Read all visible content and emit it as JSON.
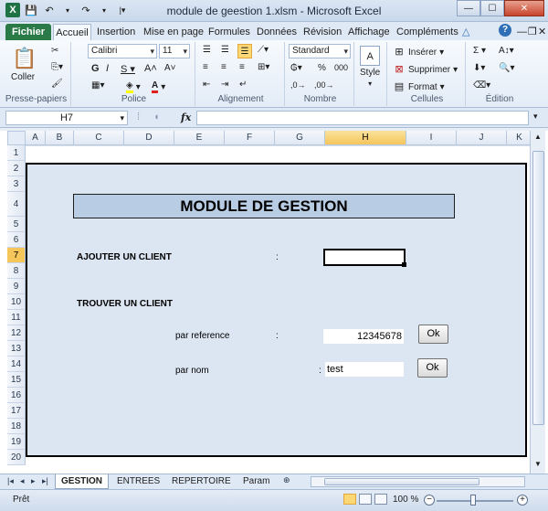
{
  "window": {
    "title": "module de geestion 1.xlsm  -  Microsoft Excel"
  },
  "ribbon": {
    "tabs": [
      "Fichier",
      "Accueil",
      "Insertion",
      "Mise en page",
      "Formules",
      "Données",
      "Révision",
      "Affichage",
      "Compléments"
    ],
    "active_tab": "Accueil",
    "clipboard": {
      "paste_label": "Coller",
      "group_label": "Presse-papiers"
    },
    "font": {
      "name": "Calibri",
      "size": "11",
      "group_label": "Police"
    },
    "alignment": {
      "group_label": "Alignement"
    },
    "number": {
      "format": "Standard",
      "group_label": "Nombre"
    },
    "styles": {
      "label": "Style"
    },
    "cells": {
      "insert": "Insérer",
      "delete": "Supprimer",
      "format": "Format",
      "group_label": "Cellules"
    },
    "editing": {
      "group_label": "Édition"
    }
  },
  "formula_bar": {
    "cell_ref": "H7",
    "fx": "fx",
    "content": ""
  },
  "grid": {
    "columns": [
      "A",
      "B",
      "C",
      "D",
      "E",
      "F",
      "G",
      "H",
      "I",
      "J",
      "K"
    ],
    "selected_column": "H",
    "rows": [
      "1",
      "2",
      "3",
      "4",
      "5",
      "6",
      "7",
      "8",
      "9",
      "10",
      "11",
      "12",
      "13",
      "14",
      "15",
      "16",
      "17",
      "18",
      "19",
      "20"
    ],
    "selected_row": "7"
  },
  "sheet": {
    "title": "MODULE DE GESTION",
    "add_client_label": "AJOUTER UN CLIENT",
    "colon": ":",
    "find_client_label": "TROUVER UN CLIENT",
    "by_reference_label": "par reference",
    "reference_value": "12345678",
    "by_name_label": "par nom",
    "name_value": "test",
    "ok_label": "Ok"
  },
  "sheet_tabs": {
    "tabs": [
      "GESTION",
      "ENTREES",
      "REPERTOIRE",
      "Param"
    ],
    "active": "GESTION"
  },
  "status": {
    "text": "Prêt",
    "zoom": "100 %"
  }
}
